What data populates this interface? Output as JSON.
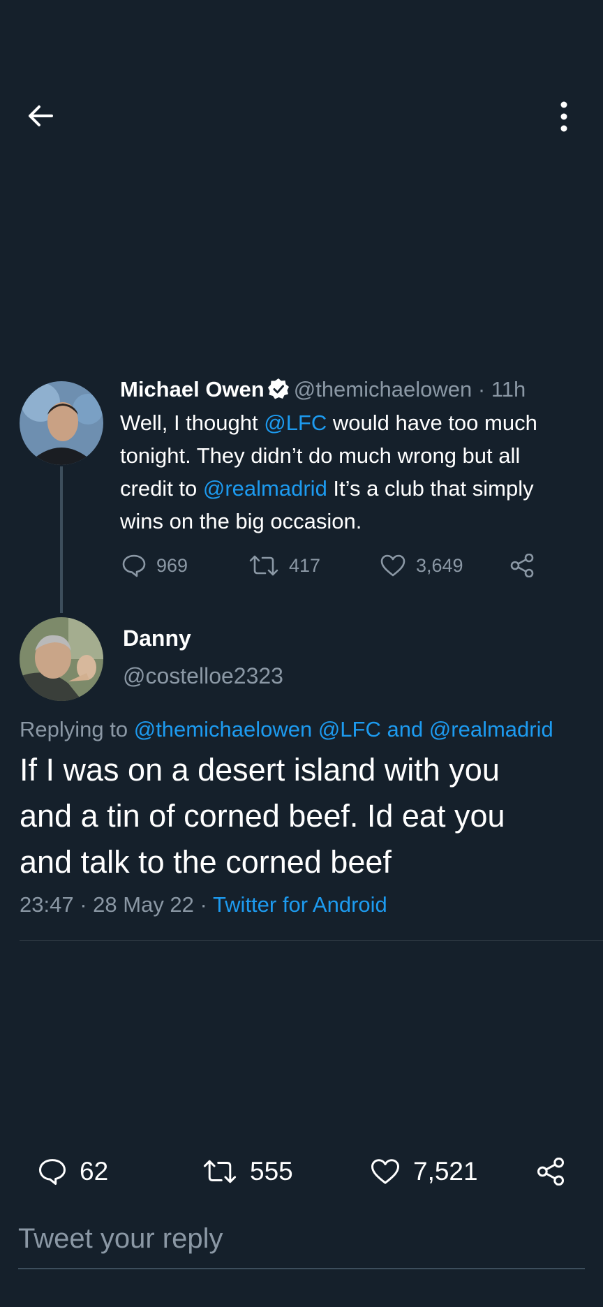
{
  "topbar": {
    "back_icon": "arrow-left-icon",
    "more_icon": "more-vertical-icon"
  },
  "parent_tweet": {
    "name": "Michael Owen",
    "handle": "@themichaelowen",
    "separator": "·",
    "time": "11h",
    "body": {
      "line1_a": "Well, I thought ",
      "line1_mention": "@LFC",
      "line1_b": " would have too much",
      "line2": "tonight. They didn’t do much wrong but all",
      "line3_a": "credit to ",
      "line3_mention": "@realmadrid",
      "line3_b": " It’s a club that simply",
      "line4": "wins on the big occasion."
    },
    "actions": {
      "replies": "969",
      "retweets": "417",
      "likes": "3,649"
    }
  },
  "reply_tweet": {
    "name": "Danny",
    "handle": "@costelloe2323",
    "replying_prefix": "Replying to ",
    "replying_mentions": "@themichaelowen @LFC and @realmadrid",
    "body": {
      "line1": "If I was on a desert island with you",
      "line2": "and a tin of corned beef. Id eat you",
      "line3": "and talk to the corned beef"
    },
    "time": "23:47",
    "date": "28 May 22",
    "separator": "·",
    "source": "Twitter for Android",
    "stats": {
      "replies": "62",
      "retweets": "555",
      "likes": "7,521"
    }
  },
  "reply_box": {
    "placeholder": "Tweet your reply"
  },
  "colors": {
    "background": "#15202b",
    "link": "#1d9bf0",
    "muted": "#8b98a5",
    "divider": "#38444d"
  }
}
